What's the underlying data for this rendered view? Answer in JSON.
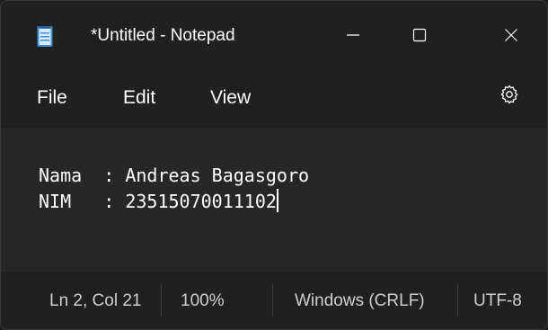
{
  "window": {
    "title": "*Untitled - Notepad",
    "icons": {
      "app": "notepad-icon",
      "minimize": "minimize-icon",
      "maximize": "maximize-icon",
      "close": "close-icon",
      "settings": "gear-icon"
    }
  },
  "menu": {
    "file": "File",
    "edit": "Edit",
    "view": "View"
  },
  "editor": {
    "lines": [
      "Nama  : Andreas Bagasgoro",
      "NIM   : 23515070011102"
    ]
  },
  "status": {
    "position": "Ln 2, Col 21",
    "zoom": "100%",
    "line_ending": "Windows (CRLF)",
    "encoding": "UTF-8"
  },
  "colors": {
    "background": "#202020",
    "editor_background": "#272727",
    "text": "#ffffff",
    "status_text": "#cfcfcf",
    "icon_accent": "#3b8ed8"
  }
}
